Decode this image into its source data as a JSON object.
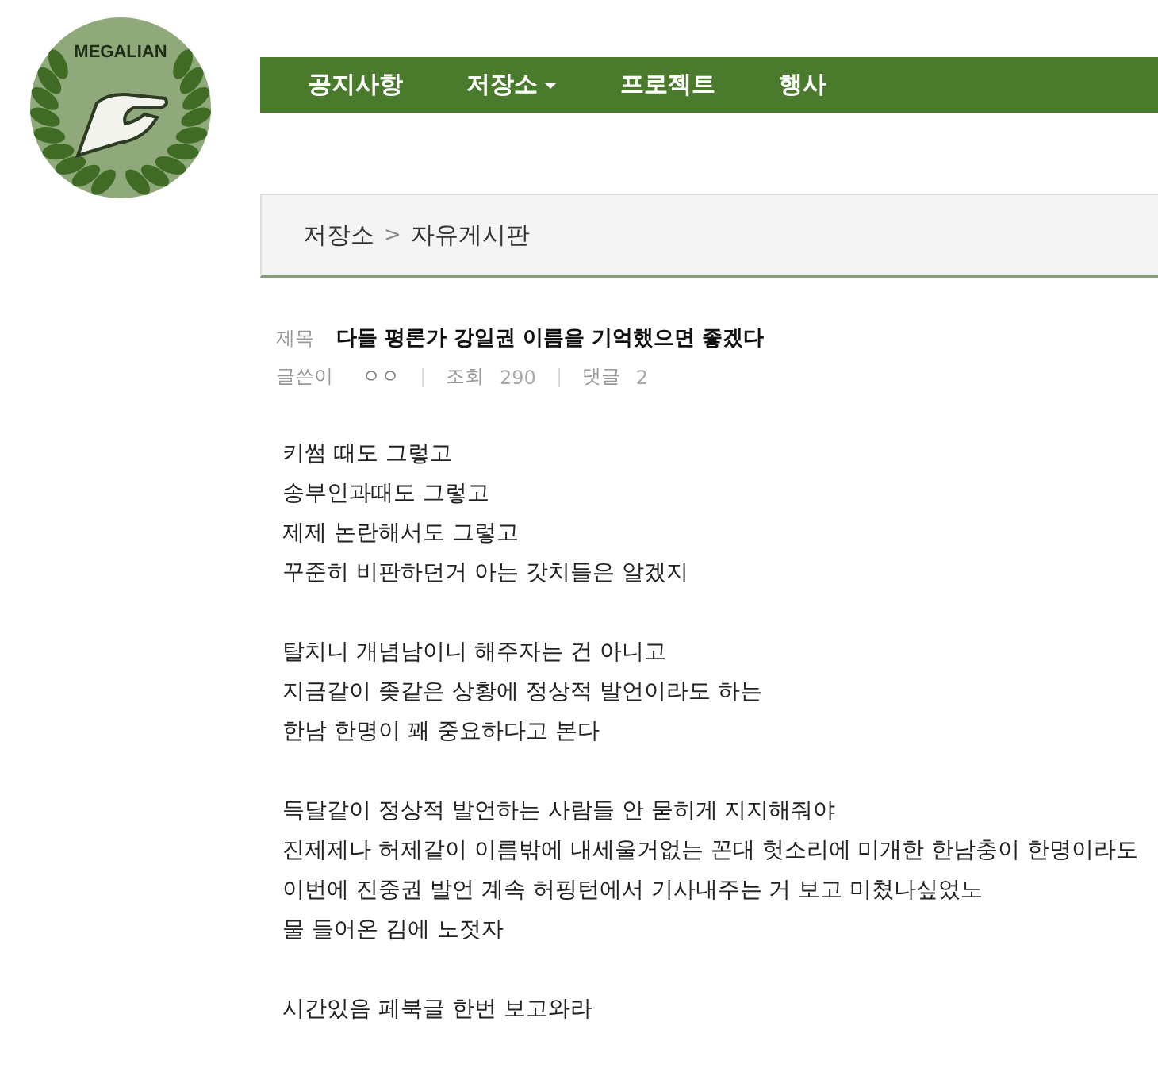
{
  "logo": {
    "text": "MEGALIAN"
  },
  "nav": [
    {
      "label": "공지사항",
      "dropdown": false
    },
    {
      "label": "저장소",
      "dropdown": true
    },
    {
      "label": "프로젝트",
      "dropdown": false
    },
    {
      "label": "행사",
      "dropdown": false
    }
  ],
  "breadcrumb": {
    "parent": "저장소",
    "separator": ">",
    "current": "자유게시판"
  },
  "post": {
    "title_label": "제목",
    "title": "다들 평론가 강일권 이름을 기억했으면 좋겠다",
    "meta": [
      {
        "label": "글쓴이",
        "value": "ㅇㅇ"
      },
      {
        "label": "조회",
        "value": "290"
      },
      {
        "label": "댓글",
        "value": "2"
      }
    ],
    "paragraphs": [
      [
        "키썸 때도 그렇고",
        "송부인과때도 그렇고",
        "제제 논란해서도 그렇고",
        "꾸준히 비판하던거 아는 갓치들은 알겠지"
      ],
      [
        "탈치니 개념남이니 해주자는 건 아니고",
        "지금같이 좆같은 상황에 정상적 발언이라도 하는",
        "한남 한명이 꽤 중요하다고 본다"
      ],
      [
        "득달같이 정상적 발언하는 사람들 안 묻히게 지지해줘야",
        "진제제나 허제같이 이름밖에 내세울거없는 꼰대 헛소리에 미개한 한남충이 한명이라도",
        "이번에 진중권 발언 계속 허핑턴에서 기사내주는 거 보고 미쳤나싶었노",
        "물 들어온 김에 노젓자"
      ],
      [
        "시간있음 페북글 한번 보고와라"
      ]
    ]
  }
}
